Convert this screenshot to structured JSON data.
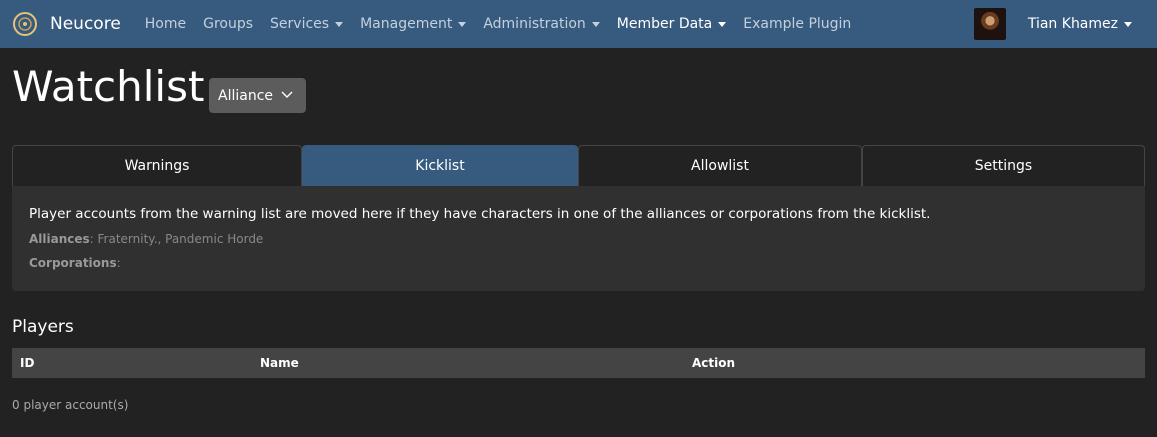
{
  "navbar": {
    "brand": "Neucore",
    "items": [
      {
        "label": "Home",
        "dropdown": false
      },
      {
        "label": "Groups",
        "dropdown": false
      },
      {
        "label": "Services",
        "dropdown": true
      },
      {
        "label": "Management",
        "dropdown": true
      },
      {
        "label": "Administration",
        "dropdown": true
      },
      {
        "label": "Member Data",
        "dropdown": true,
        "active": true
      },
      {
        "label": "Example Plugin",
        "dropdown": false
      }
    ],
    "user_name": "Tian Khamez"
  },
  "header": {
    "title": "Watchlist",
    "select_value": "Alliance"
  },
  "tabs": [
    {
      "label": "Warnings",
      "active": false
    },
    {
      "label": "Kicklist",
      "active": true
    },
    {
      "label": "Allowlist",
      "active": false
    },
    {
      "label": "Settings",
      "active": false
    }
  ],
  "info": {
    "description": "Player accounts from the warning list are moved here if they have characters in one of the alliances or corporations from the kicklist.",
    "alliances_label": "Alliances",
    "alliances_value": ": Fraternity., Pandemic Horde",
    "corporations_label": "Corporations",
    "corporations_value": ":"
  },
  "players": {
    "title": "Players",
    "columns": [
      "ID",
      "Name",
      "Action"
    ],
    "count_text": "0 player account(s)"
  },
  "colors": {
    "navbar": "#375a7f",
    "background": "#222222",
    "card": "#303030",
    "table_head": "#444444"
  }
}
